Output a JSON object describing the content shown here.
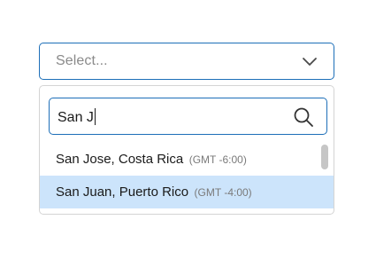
{
  "select": {
    "placeholder": "Select...",
    "chevron_icon": "chevron-down-icon"
  },
  "search": {
    "value": "San J",
    "icon": "search-icon"
  },
  "options": [
    {
      "name": "San Jose, Costa Rica",
      "timezone": "(GMT -6:00)",
      "highlighted": false
    },
    {
      "name": "San Juan, Puerto Rico",
      "timezone": "(GMT -4:00)",
      "highlighted": true
    }
  ],
  "colors": {
    "focus_border": "#1d6fb8",
    "highlight_bg": "#cce4fb",
    "panel_border": "#d4d4d4",
    "placeholder_text": "#8a8a8a",
    "secondary_text": "#7a7a7a",
    "scrollbar_thumb": "#c6c6c6"
  }
}
